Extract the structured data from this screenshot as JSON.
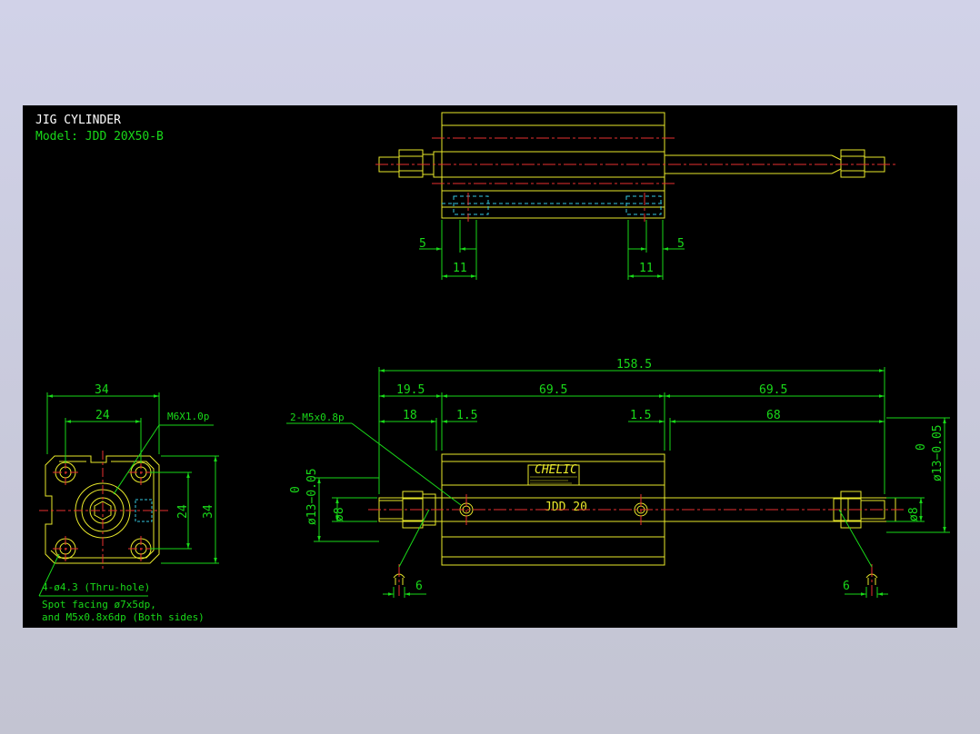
{
  "title_block": {
    "title": "JIG CYLINDER",
    "model": "Model: JDD 20X50-B"
  },
  "top_view": {
    "dims": {
      "left_small": "5",
      "left_width": "11",
      "right_width": "11",
      "right_small": "5"
    }
  },
  "end_view": {
    "dims": {
      "overall_width": "34",
      "hole_pitch_h": "24",
      "hole_pitch_v": "24",
      "overall_height": "34"
    },
    "thread_label": "M6X1.0p",
    "hole_note_1": "4-ø4.3 (Thru-hole)",
    "hole_note_2": "Spot facing ø7x5dp,",
    "hole_note_3": "and M5x0.8x6dp (Both sides)"
  },
  "side_view": {
    "dims": {
      "overall": "158.5",
      "left_offset": "19.5",
      "mid_span": "69.5",
      "right_span": "69.5",
      "rod_left": "18",
      "gap_left": "1.5",
      "gap_right": "1.5",
      "rod_right": "68",
      "nut_left": "6",
      "nut_right": "6",
      "rod_dia_left": "ø8",
      "rod_dia_right": "ø8",
      "tol_left_zero": "0",
      "tol_left": "ø13−0.05",
      "tol_right_zero": "0",
      "tol_right": "ø13−0.05"
    },
    "port_label": "2-M5x0.8p",
    "nameplate_brand": "CHELIC",
    "body_marking": "JDD 20"
  },
  "colors": {
    "outline": "#e8e82a",
    "center": "#e83030",
    "dimension": "#19d919",
    "hidden": "#33c8e0",
    "background": "#000000"
  }
}
